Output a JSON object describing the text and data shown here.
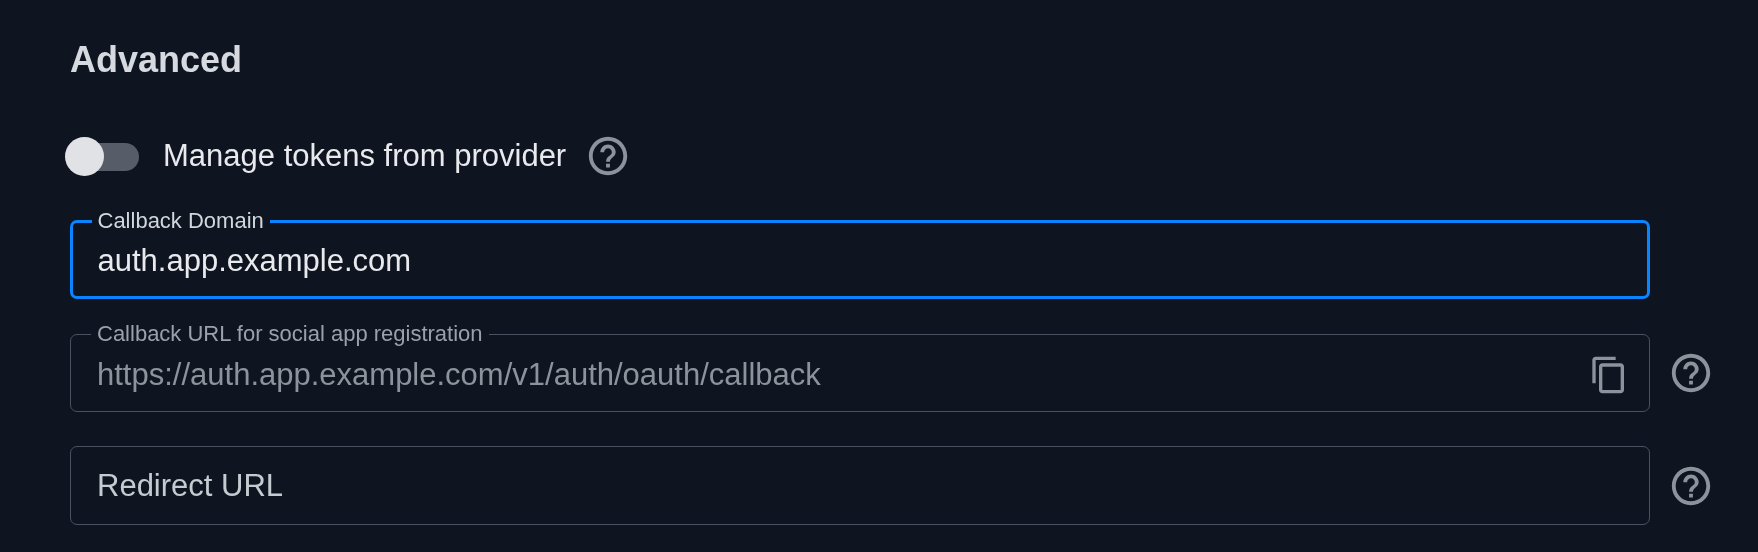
{
  "section": {
    "title": "Advanced"
  },
  "toggle": {
    "label": "Manage tokens from provider",
    "on": false,
    "help": true
  },
  "fields": [
    {
      "label": "Callback Domain",
      "value": "auth.app.example.com",
      "focused": true,
      "disabled": false,
      "copy": false,
      "help": false
    },
    {
      "label": "Callback URL for social app registration",
      "value": "https://auth.app.example.com/v1/auth/oauth/callback",
      "focused": false,
      "disabled": true,
      "copy": true,
      "help": true
    },
    {
      "placeholder": "Redirect URL",
      "focused": false,
      "disabled": false,
      "copy": false,
      "help": true
    }
  ]
}
